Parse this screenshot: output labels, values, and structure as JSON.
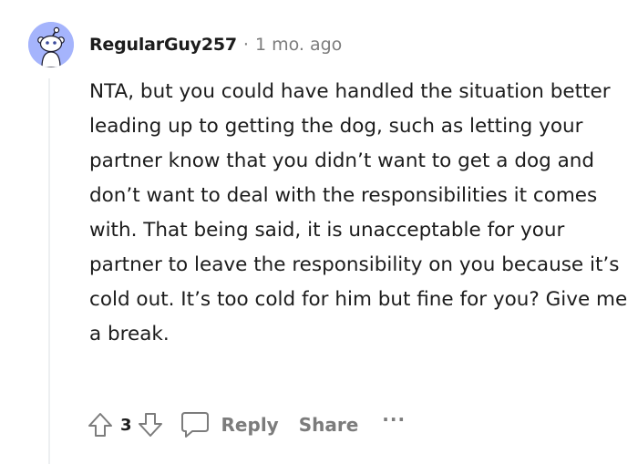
{
  "comment": {
    "author": "RegularGuy257",
    "separator": "·",
    "timestamp": "1 mo. ago",
    "body": "NTA, but you could have handled the situation better leading up to getting the dog, such as letting your partner know that you didn’t want to get a dog and don’t want to deal with the responsibilities it comes with. That being said, it is unacceptable for your partner to leave the responsibility on you because it’s cold out. It’s too cold for him but fine for you? Give me a break.",
    "avatar_icon": "reddit-snoo-avatar-icon"
  },
  "actions": {
    "upvote_icon": "upvote-arrow-icon",
    "score": "3",
    "downvote_icon": "downvote-arrow-icon",
    "reply_icon": "speech-bubble-icon",
    "reply_label": "Reply",
    "share_label": "Share",
    "more_label": "···"
  },
  "colors": {
    "avatar_bg": "#a5b4fc",
    "text": "#1c1c1c",
    "muted": "#7c7c7c",
    "thread_line": "#edeff1"
  }
}
